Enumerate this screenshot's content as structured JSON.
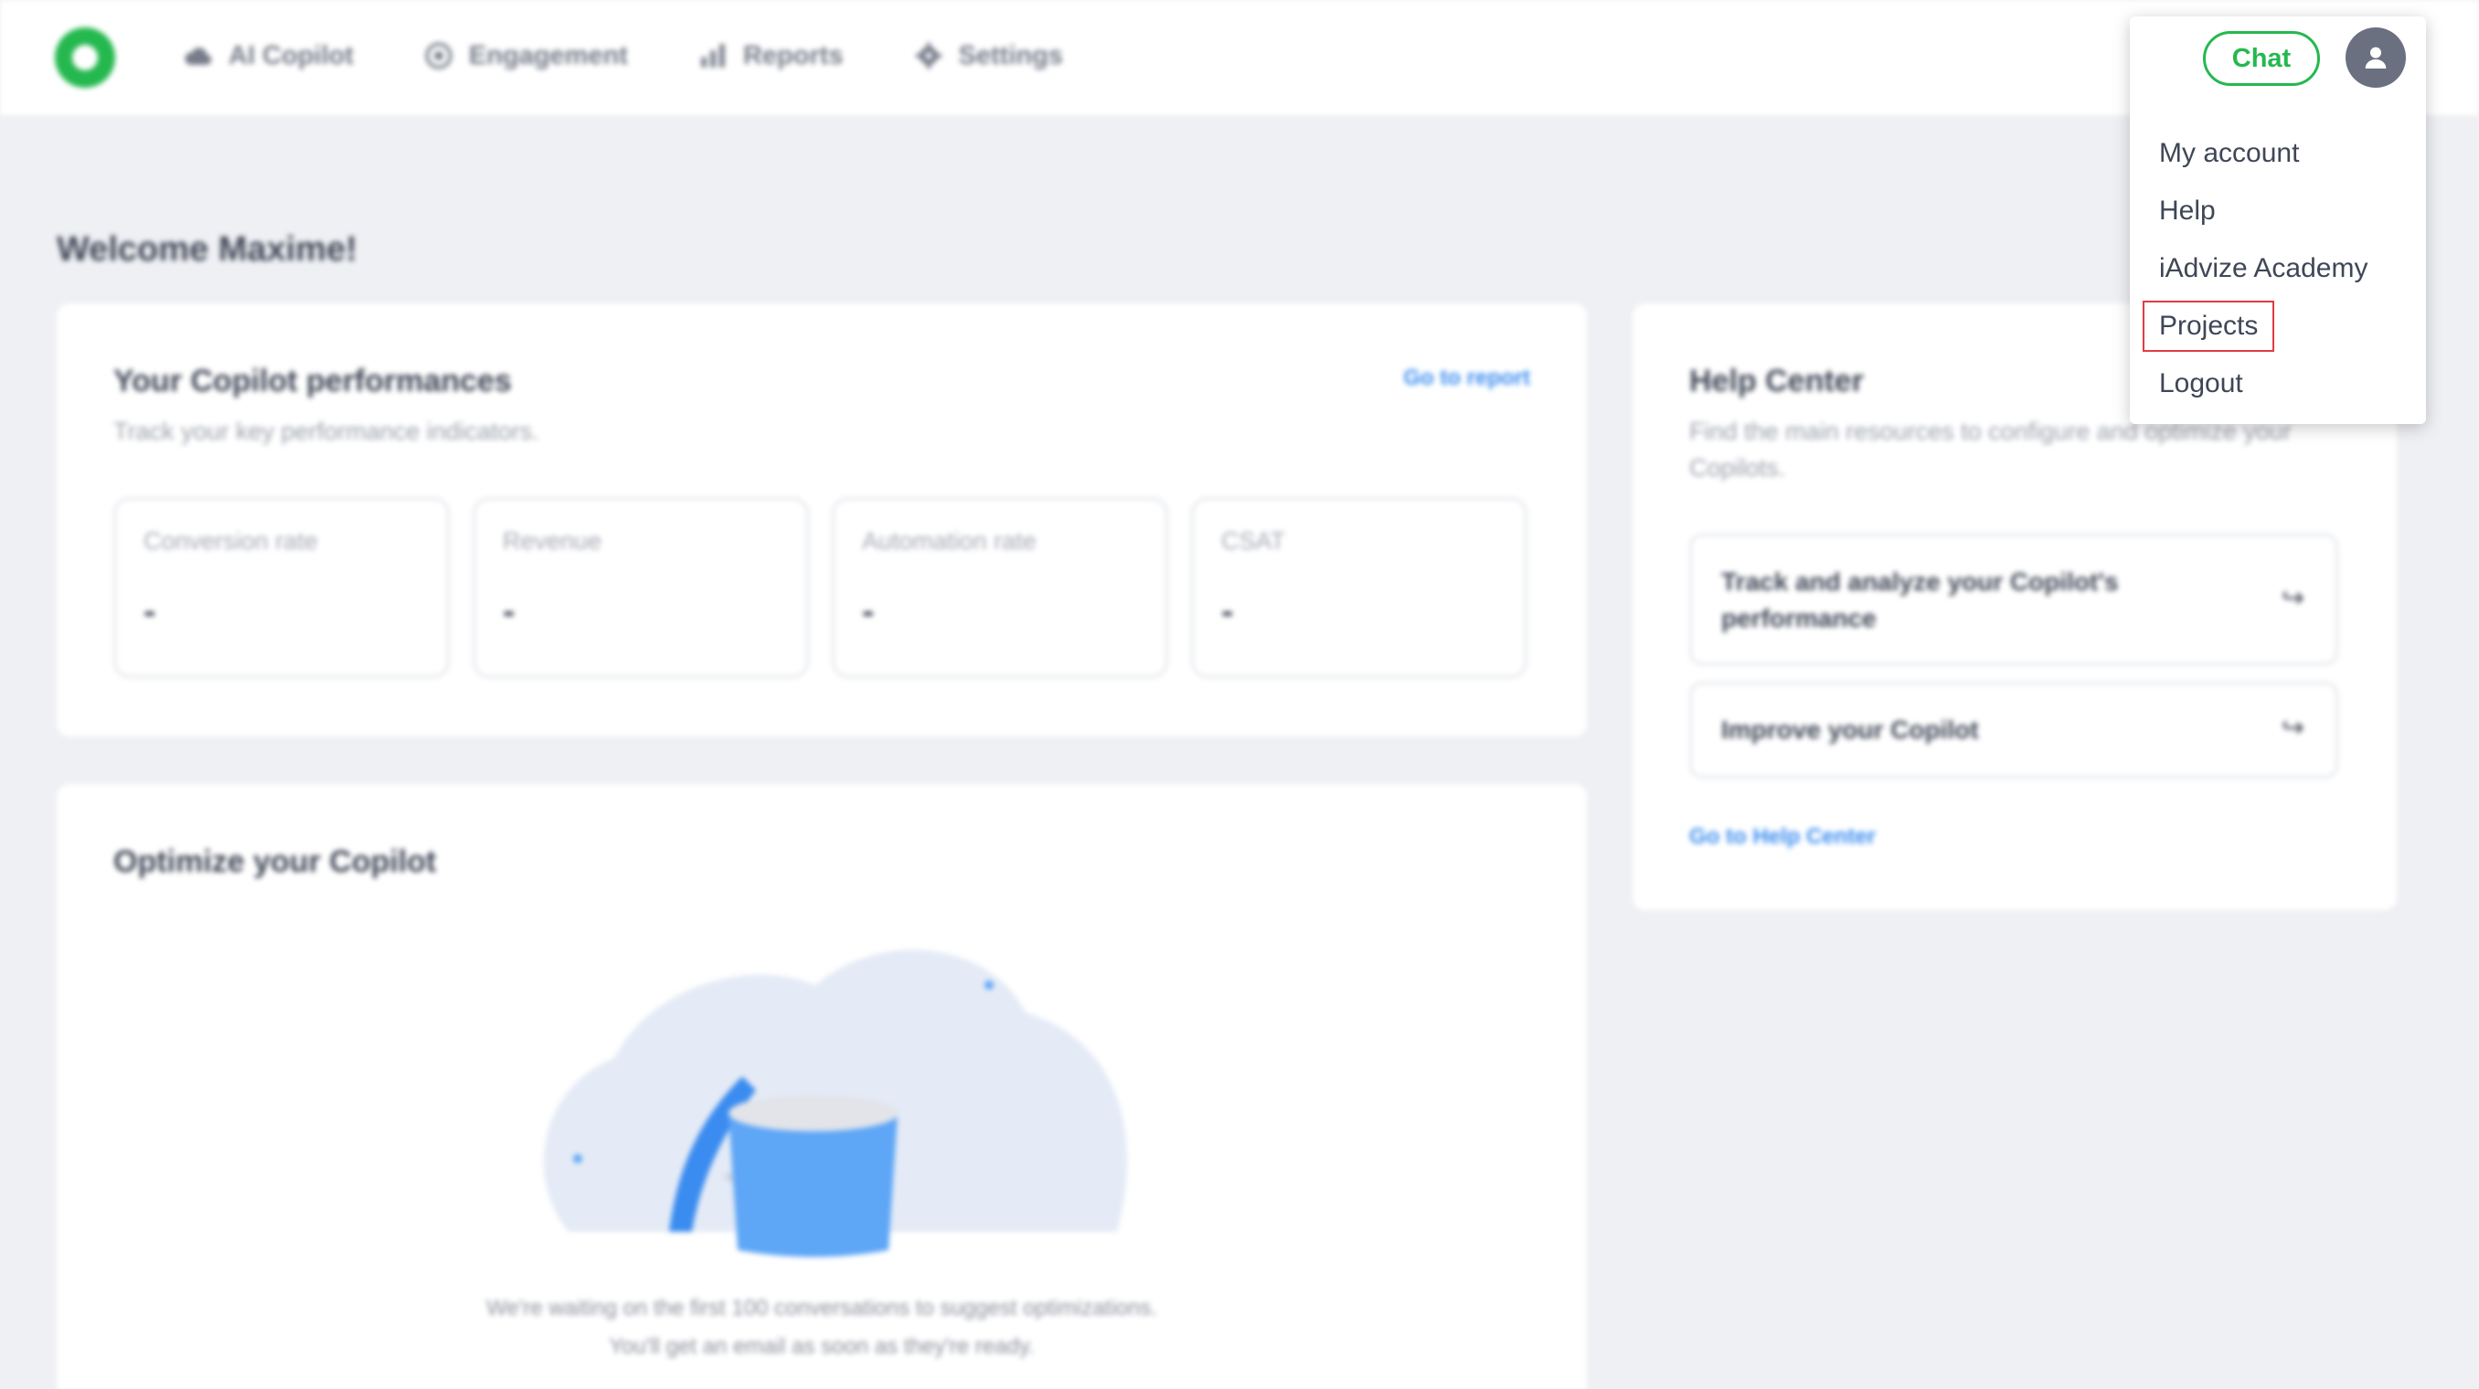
{
  "nav": {
    "items": [
      {
        "label": "AI Copilot",
        "icon": "cloud-icon"
      },
      {
        "label": "Engagement",
        "icon": "target-icon"
      },
      {
        "label": "Reports",
        "icon": "bar-chart-icon"
      },
      {
        "label": "Settings",
        "icon": "gear-icon"
      }
    ]
  },
  "welcome": "Welcome Maxime!",
  "performance": {
    "title": "Your Copilot performances",
    "subtitle": "Track your key performance indicators.",
    "link": "Go to report",
    "kpis": [
      {
        "label": "Conversion rate",
        "value": "-"
      },
      {
        "label": "Revenue",
        "value": "-"
      },
      {
        "label": "Automation rate",
        "value": "-"
      },
      {
        "label": "CSAT",
        "value": "-"
      }
    ]
  },
  "optimize": {
    "title": "Optimize your Copilot",
    "line1": "We're waiting on the first 100 conversations to suggest optimizations.",
    "line2": "You'll get an email as soon as they're ready."
  },
  "help_center": {
    "title": "Help Center",
    "subtitle": "Find the main resources to configure and optimize your Copilots.",
    "items": [
      {
        "label": "Track and analyze your Copilot's performance"
      },
      {
        "label": "Improve your Copilot"
      }
    ],
    "link": "Go to Help Center"
  },
  "dropdown": {
    "chat_label": "Chat",
    "items": [
      {
        "label": "My account"
      },
      {
        "label": "Help"
      },
      {
        "label": "iAdvize Academy"
      },
      {
        "label": "Projects"
      },
      {
        "label": "Logout"
      }
    ]
  },
  "colors": {
    "brand_green": "#25b84f",
    "link_blue": "#3b8cf0",
    "background": "#eff0f4",
    "highlight_red": "#e03c44"
  }
}
